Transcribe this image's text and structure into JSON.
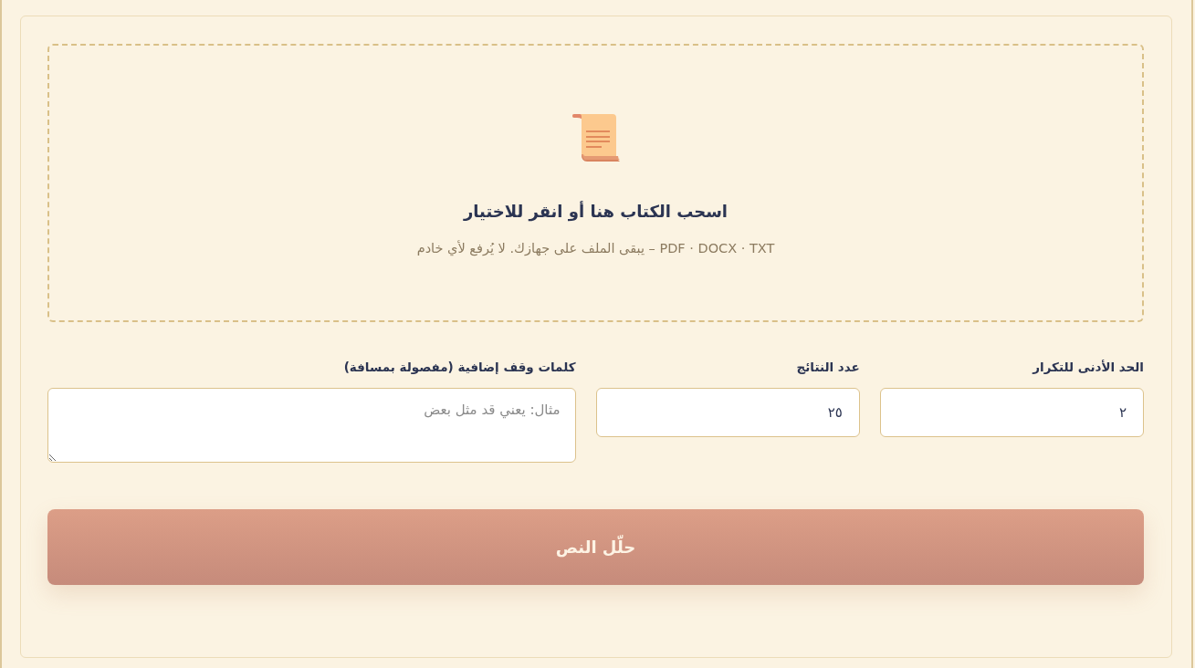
{
  "dropzone": {
    "title": "اسحب الكتاب هنا أو انقر للاختيار",
    "hint": "PDF · DOCX · TXT – يبقى الملف على جهازك. لا يُرفع لأي خادم"
  },
  "fields": [
    {
      "kind": "input",
      "label": "الحد الأدنى للتكرار",
      "value": "٢"
    },
    {
      "kind": "input",
      "label": "عدد النتائج",
      "value": "٢٥"
    },
    {
      "kind": "textarea",
      "label": "كلمات وقف إضافية (مفصولة بمسافة)",
      "placeholder": "مثال: يعني قد مثل بعض"
    }
  ],
  "analyze_button": {
    "label": "حلّل النص"
  }
}
